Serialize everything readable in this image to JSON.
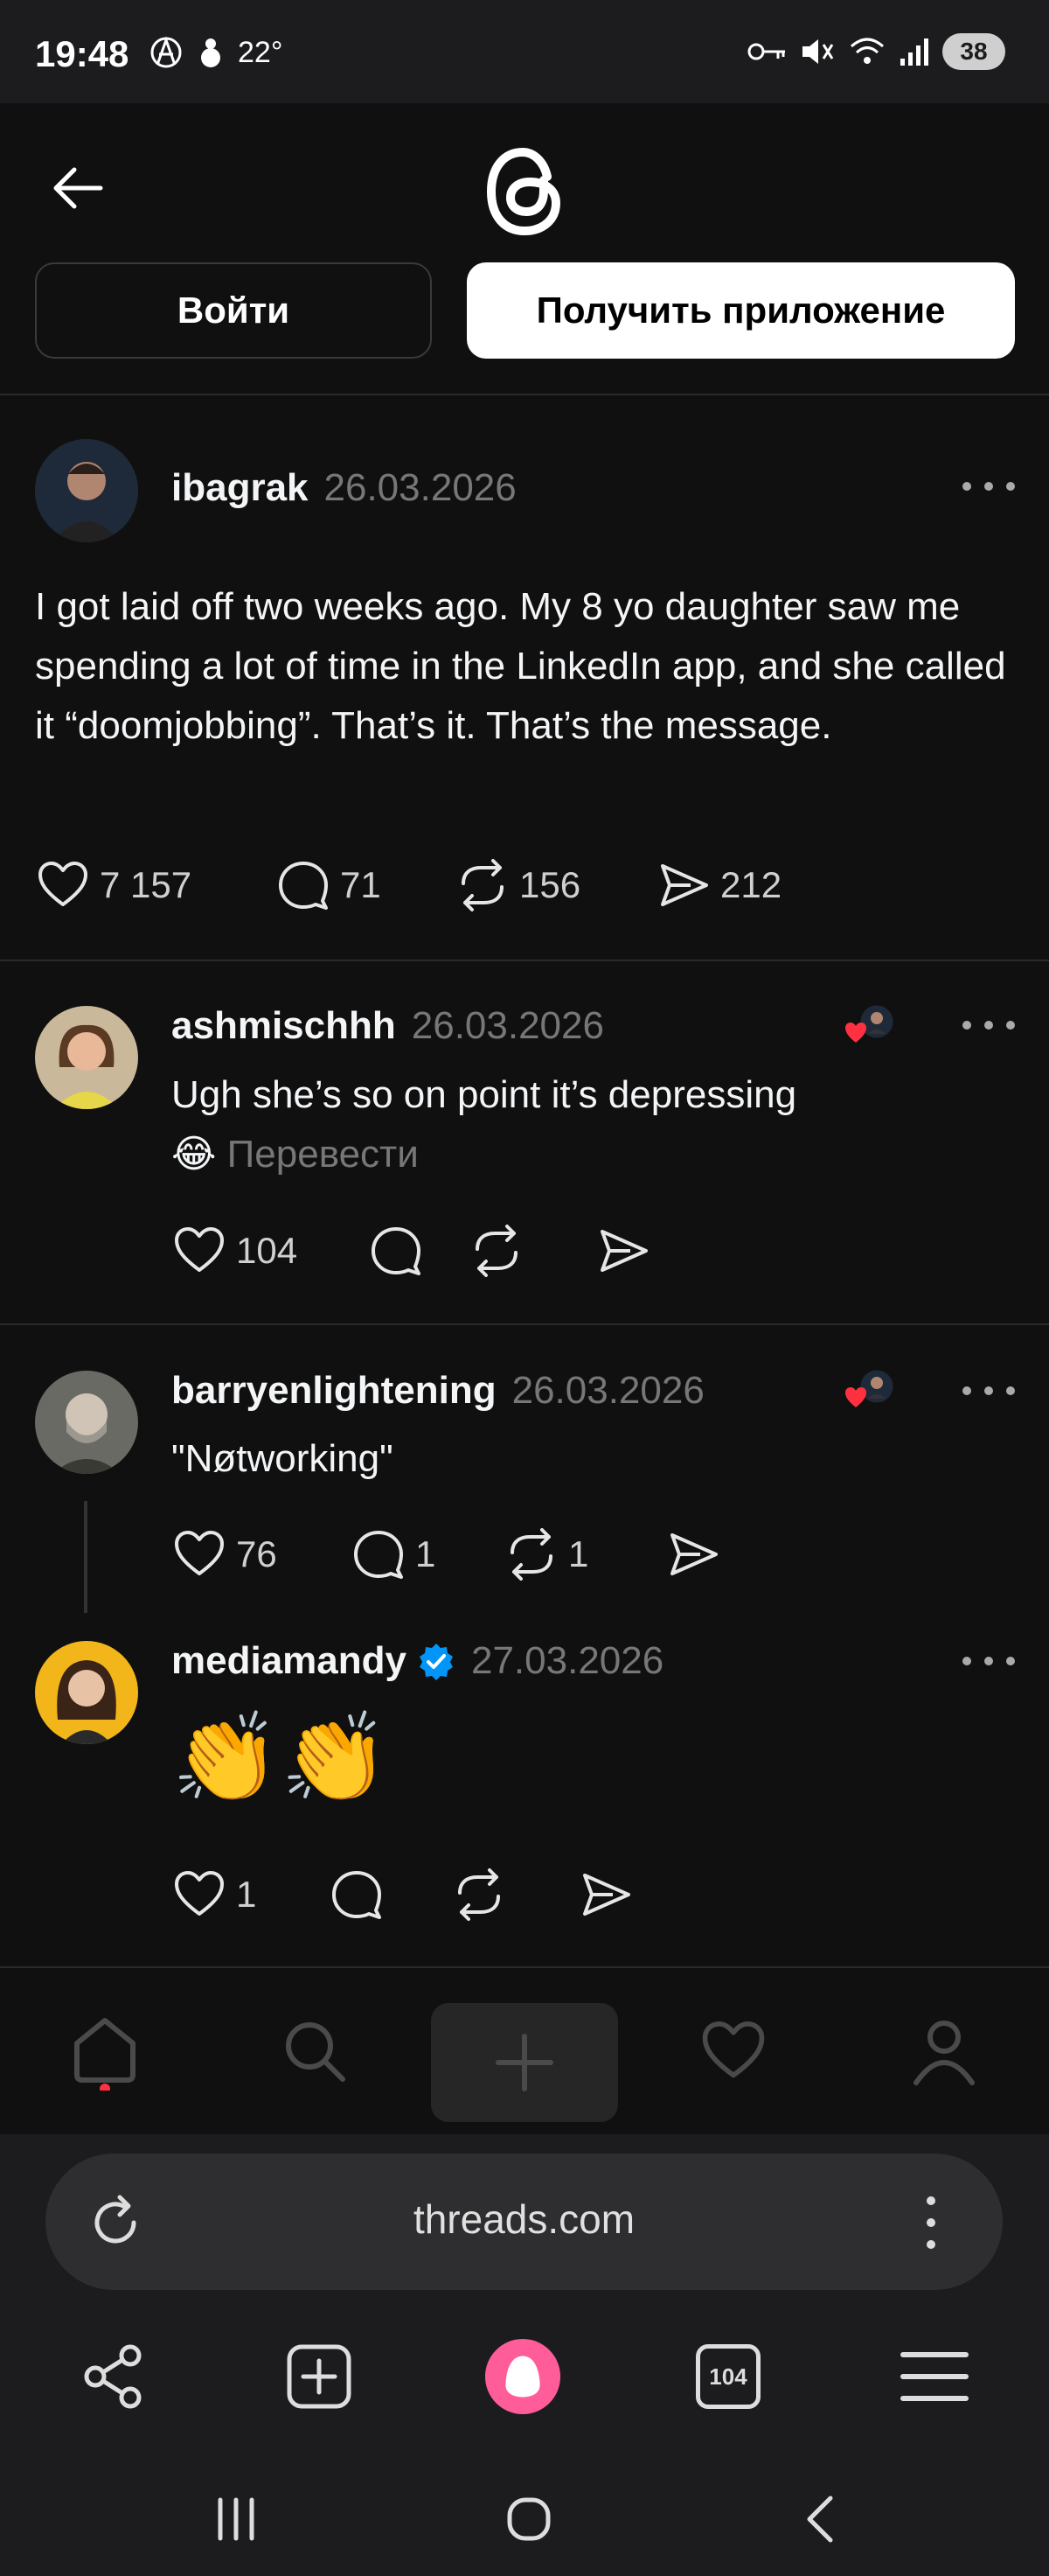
{
  "status_bar": {
    "time": "19:48",
    "temperature": "22°",
    "battery": "38"
  },
  "header": {
    "login_label": "Войти",
    "get_app_label": "Получить приложение"
  },
  "main_post": {
    "username": "ibagrak",
    "date": "26.03.2026",
    "text": "I got laid off two weeks ago. My 8 yo daughter saw me spending a lot of time in the LinkedIn app, and she called it “doomjobbing”. That’s it. That’s the message.",
    "likes": "7 157",
    "replies": "71",
    "reposts": "156",
    "shares": "212"
  },
  "replies": [
    {
      "username": "ashmischhh",
      "date": "26.03.2026",
      "text": "Ugh she’s so on point it’s depressing",
      "emoji": "😂",
      "translate": "Перевести",
      "likes": "104"
    },
    {
      "username": "barryenlightening",
      "date": "26.03.2026",
      "text": "\"Nøtworking\"",
      "likes": "76",
      "replies": "1",
      "reposts": "1"
    },
    {
      "username": "mediamandy",
      "date": "27.03.2026",
      "emoji": "👏👏",
      "likes": "1"
    }
  ],
  "browser": {
    "url": "threads.com",
    "tabs_count": "104"
  },
  "colors": {
    "background": "#101010",
    "like_red": "#ff3040",
    "verified_blue": "#0095f6",
    "alice_pink": "#ff5c9a"
  }
}
